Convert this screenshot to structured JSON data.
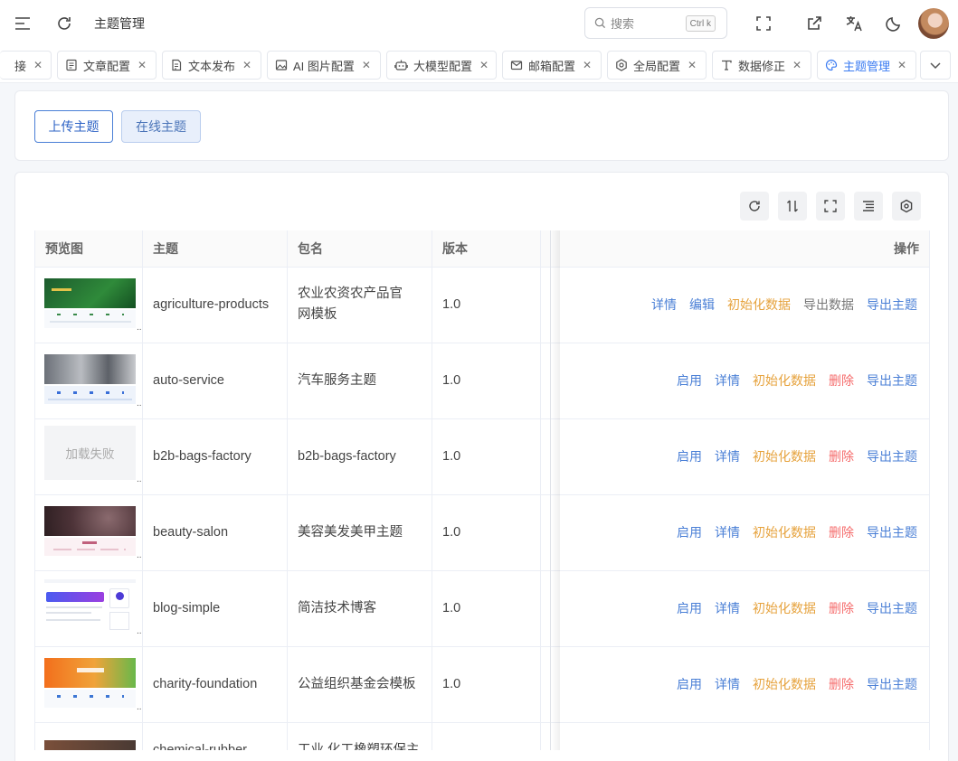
{
  "header": {
    "title": "主题管理",
    "search_placeholder": "搜索",
    "search_shortcut": "Ctrl k"
  },
  "tabs": [
    {
      "label": "接",
      "icon": "none"
    },
    {
      "label": "文章配置",
      "icon": "document-icon"
    },
    {
      "label": "文本发布",
      "icon": "file-text-icon"
    },
    {
      "label": "AI 图片配置",
      "icon": "image-icon"
    },
    {
      "label": "大模型配置",
      "icon": "robot-icon"
    },
    {
      "label": "邮箱配置",
      "icon": "mail-icon"
    },
    {
      "label": "全局配置",
      "icon": "gear-icon"
    },
    {
      "label": "数据修正",
      "icon": "type-icon"
    },
    {
      "label": "主题管理",
      "icon": "palette-icon",
      "active": true
    }
  ],
  "buttons": {
    "upload": "上传主题",
    "online": "在线主题"
  },
  "table": {
    "columns": [
      "预览图",
      "主题",
      "包名",
      "版本",
      "操作"
    ],
    "load_failed": "加载失败",
    "rows": [
      {
        "theme": "agriculture-products",
        "package": "农业农资农产品官网模板",
        "version": "1.0",
        "actions": [
          "详情",
          "编辑",
          "初始化数据",
          "导出数据",
          "导出主题"
        ]
      },
      {
        "theme": "auto-service",
        "package": "汽车服务主题",
        "version": "1.0",
        "actions": [
          "启用",
          "详情",
          "初始化数据",
          "删除",
          "导出主题"
        ]
      },
      {
        "theme": "b2b-bags-factory",
        "package": "b2b-bags-factory",
        "version": "1.0",
        "actions": [
          "启用",
          "详情",
          "初始化数据",
          "删除",
          "导出主题"
        ]
      },
      {
        "theme": "beauty-salon",
        "package": "美容美发美甲主题",
        "version": "1.0",
        "actions": [
          "启用",
          "详情",
          "初始化数据",
          "删除",
          "导出主题"
        ]
      },
      {
        "theme": "blog-simple",
        "package": "简洁技术博客",
        "version": "1.0",
        "actions": [
          "启用",
          "详情",
          "初始化数据",
          "删除",
          "导出主题"
        ]
      },
      {
        "theme": "charity-foundation",
        "package": "公益组织基金会模板",
        "version": "1.0",
        "actions": [
          "启用",
          "详情",
          "初始化数据",
          "删除",
          "导出主题"
        ]
      },
      {
        "theme": "chemical-rubber",
        "package": "工业 化工橡塑环保主",
        "version": "",
        "actions": []
      }
    ]
  },
  "colors": {
    "primary": "#4a7fd6",
    "warning": "#e6a23c",
    "danger": "#f56c6c"
  }
}
